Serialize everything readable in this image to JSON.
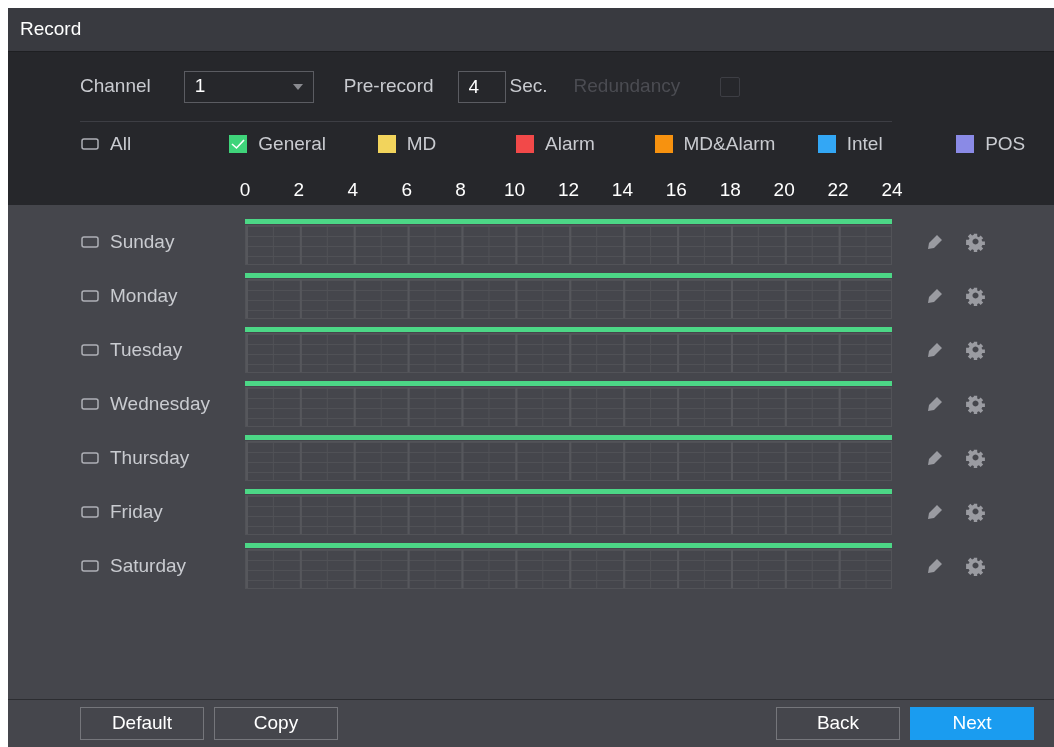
{
  "window": {
    "title": "Record"
  },
  "channel": {
    "label": "Channel",
    "value": "1"
  },
  "prerecord": {
    "label": "Pre-record",
    "value": "4",
    "unit": "Sec."
  },
  "redundancy": {
    "label": "Redundancy",
    "disabled": true,
    "checked": false
  },
  "legend": [
    {
      "kind": "toggle",
      "label": "All",
      "checked": false
    },
    {
      "kind": "type",
      "label": "General",
      "color": "#3fd47a",
      "checked": true
    },
    {
      "kind": "type",
      "label": "MD",
      "color": "#f2d45c",
      "checked": false
    },
    {
      "kind": "type",
      "label": "Alarm",
      "color": "#f24949",
      "checked": false
    },
    {
      "kind": "type",
      "label": "MD&Alarm",
      "color": "#f7920f",
      "checked": false
    },
    {
      "kind": "type",
      "label": "Intel",
      "color": "#33a7f5",
      "checked": false
    },
    {
      "kind": "type",
      "label": "POS",
      "color": "#8a8ae6",
      "checked": false
    }
  ],
  "hours": [
    "0",
    "2",
    "4",
    "6",
    "8",
    "10",
    "12",
    "14",
    "16",
    "18",
    "20",
    "22",
    "24"
  ],
  "days": [
    {
      "label": "Sunday",
      "checked": false,
      "recorded": true
    },
    {
      "label": "Monday",
      "checked": false,
      "recorded": true
    },
    {
      "label": "Tuesday",
      "checked": false,
      "recorded": true
    },
    {
      "label": "Wednesday",
      "checked": false,
      "recorded": true
    },
    {
      "label": "Thursday",
      "checked": false,
      "recorded": true
    },
    {
      "label": "Friday",
      "checked": false,
      "recorded": true
    },
    {
      "label": "Saturday",
      "checked": false,
      "recorded": true
    }
  ],
  "buttons": [
    {
      "label": "Default",
      "primary": false
    },
    {
      "label": "Copy",
      "primary": false
    },
    {
      "label": "Back",
      "primary": false
    },
    {
      "label": "Next",
      "primary": true
    }
  ]
}
